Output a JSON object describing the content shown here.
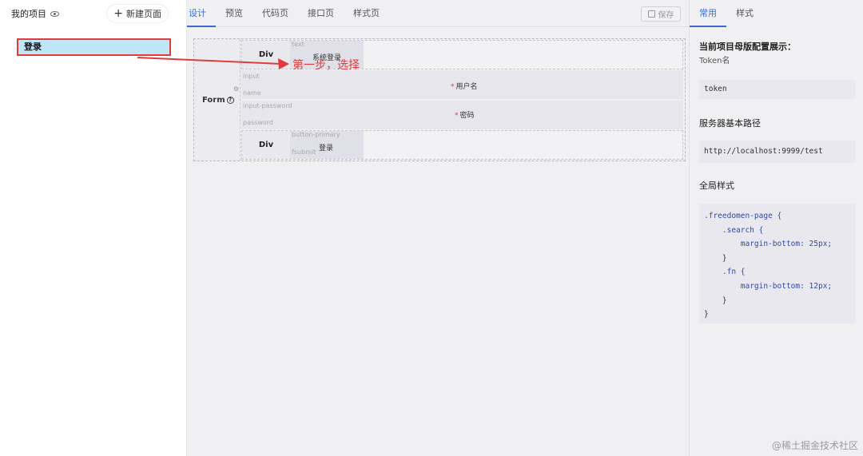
{
  "sidebar": {
    "title": "我的项目",
    "new_page_label": "新建页面",
    "pages": [
      "登录"
    ]
  },
  "main": {
    "tabs": [
      "设计",
      "预览",
      "代码页",
      "接口页",
      "样式页"
    ],
    "active_tab": "设计",
    "save_label": "保存",
    "form_label": "Form",
    "row1": {
      "div_label": "Div",
      "type_hint": "text",
      "value": "系统登录"
    },
    "row2": {
      "type_hint": "input",
      "name_hint": "name",
      "label": "用户名"
    },
    "row3": {
      "type_hint": "input-password",
      "name_hint": "password",
      "label": "密码"
    },
    "row4": {
      "div_label": "Div",
      "type_hint": "button-primary",
      "name_hint": "fsubmit",
      "value": "登录"
    }
  },
  "annotation": "第一步，选择",
  "right": {
    "tabs": [
      "常用",
      "样式"
    ],
    "active_tab": "常用",
    "section_title": "当前项目母版配置展示：",
    "token_label": "Token名",
    "token_value": "token",
    "base_path_label": "服务器基本路径",
    "base_path_value": "http://localhost:9999/test",
    "global_style_label": "全局样式",
    "code": [
      ".freedomen-page {",
      "    .search {",
      "        margin-bottom: 25px;",
      "    }",
      "    .fn {",
      "        margin-bottom: 12px;",
      "    }",
      "}"
    ]
  },
  "watermark": "@稀土掘金技术社区"
}
